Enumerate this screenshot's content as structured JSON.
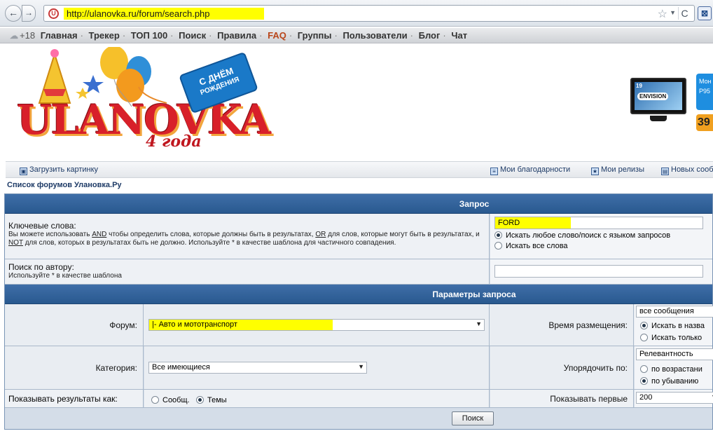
{
  "browser": {
    "url": "http://ulanovka.ru/forum/search.php",
    "back_glyph": "←",
    "forward_glyph": "→",
    "reload_glyph": "C",
    "star_glyph": "☆",
    "site_icon_glyph": "U"
  },
  "site_nav": {
    "age": "+18",
    "items": [
      {
        "label": "Главная",
        "active": false
      },
      {
        "label": "Трекер",
        "active": false
      },
      {
        "label": "ТОП 100",
        "active": false
      },
      {
        "label": "Поиск",
        "active": false
      },
      {
        "label": "Правила",
        "active": false
      },
      {
        "label": "FAQ",
        "active": true
      },
      {
        "label": "Группы",
        "active": false
      },
      {
        "label": "Пользователи",
        "active": false
      },
      {
        "label": "Блог",
        "active": false
      },
      {
        "label": "Чат",
        "active": false
      }
    ],
    "separator": "·"
  },
  "header": {
    "logo_word": "ULANOVKA",
    "logo_years": "4 года",
    "bday_line1": "С ДНЁМ",
    "bday_line2": "РОЖДЕНИЯ",
    "ad": {
      "monitor_size": "19",
      "monitor_brand": "ENVISION",
      "panel_line1": "Мон",
      "panel_line2": "P95",
      "price": "39"
    }
  },
  "link_bar": {
    "upload": "Загрузить картинку",
    "thanks": "Мои благодарности",
    "releases": "Мои релизы",
    "new": "Новых сообщ"
  },
  "forum_list_link": "Список форумов Улановка.Ру",
  "query": {
    "title": "Запрос",
    "keywords_label": "Ключевые слова:",
    "keywords_help_parts": [
      "Вы можете использовать ",
      "AND",
      " чтобы определить слова, которые должны быть в результатах, ",
      "OR",
      " для слов, которые могут быть в результатах, и ",
      "NOT",
      " для слов, которых в результатах быть не должно. Используйте * в качестве шаблона для частичного совпадения."
    ],
    "keywords_value": "FORD",
    "radio_any": "Искать любое слово/поиск с языком запросов",
    "radio_all": "Искать все слова",
    "author_label": "Поиск по автору:",
    "author_help": "Используйте * в качестве шаблона",
    "author_value": ""
  },
  "params": {
    "title": "Параметры запроса",
    "forum_label": "Форум:",
    "forum_value": "|- Авто и мототранспорт",
    "time_label": "Время размещения:",
    "time_value": "все сообщения",
    "time_radio1": "Искать в назва",
    "time_radio2": "Искать только",
    "category_label": "Категория:",
    "category_value": "Все имеющиеся",
    "order_label": "Упорядочить по:",
    "order_value": "Релевантность",
    "order_radio1": "по возрастани",
    "order_radio2": "по убыванию",
    "show_as_label": "Показывать результаты как:",
    "show_posts": "Сообщ.",
    "show_topics": "Темы",
    "show_first_label": "Показывать первые",
    "show_first_value": "200"
  },
  "search_button": "Поиск",
  "colors": {
    "header_blue": "#2f6099",
    "highlight": "#ffff00",
    "faq": "#b9461a"
  }
}
